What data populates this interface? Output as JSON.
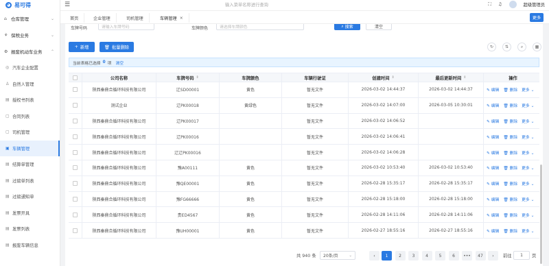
{
  "app": {
    "logo_text": "易可得"
  },
  "header": {
    "search_placeholder": "输入菜单名称进行查询",
    "user_name": "超级管理员"
  },
  "sidebar": {
    "groups": [
      {
        "label": "仓库管理"
      },
      {
        "label": "保税业务"
      },
      {
        "label": "报废机动车业务"
      }
    ],
    "items": [
      {
        "label": "汽车企业配置"
      },
      {
        "label": "自然人管理"
      },
      {
        "label": "授权书列表"
      },
      {
        "label": "合同列表"
      },
      {
        "label": "司机管理"
      },
      {
        "label": "车辆管理"
      },
      {
        "label": "结算单管理"
      },
      {
        "label": "过磅单列表"
      },
      {
        "label": "过磅通知单"
      },
      {
        "label": "发票开具"
      },
      {
        "label": "发票列表"
      },
      {
        "label": "报废车辆信息"
      }
    ]
  },
  "tabs": [
    {
      "label": "首页"
    },
    {
      "label": "企业管理"
    },
    {
      "label": "司机管理"
    },
    {
      "label": "车辆管理",
      "close": "×"
    }
  ],
  "tab_more": "更多",
  "filters": {
    "plate_label": "车牌号码",
    "plate_placeholder": "请输入车牌号码",
    "color_label": "车牌颜色",
    "color_placeholder": "请选择车牌颜色",
    "search_button": "搜索",
    "reset_button": "清空"
  },
  "toolbar": {
    "add_button": "新增",
    "batch_delete_button": "批量删除"
  },
  "selection": {
    "prefix": "当前表格已选择",
    "count": "0",
    "unit": "项",
    "clear": "清空"
  },
  "table": {
    "columns": [
      "公司名称",
      "车牌号码",
      "车牌颜色",
      "车辆行驶证",
      "创建时间",
      "最后更新时间",
      "操作"
    ],
    "actions": {
      "edit": "编辑",
      "delete": "删除",
      "more": "更多"
    },
    "rows": [
      {
        "company": "陕西秦鼎合循环科技有限公司",
        "plate": "辽SD00001",
        "color": "黄色",
        "license": "暂无文件",
        "created": "2026-03-02 14:44:37",
        "updated": "2026-03-02 14:44:37"
      },
      {
        "company": "测试企业",
        "plate": "辽PK00018",
        "color": "黄绿色",
        "license": "暂无文件",
        "created": "2026-03-02 14:07:00",
        "updated": "2026-03-05 10:30:01"
      },
      {
        "company": "陕西秦鼎合循环科技有限公司",
        "plate": "辽PK00017",
        "color": "",
        "license": "暂无文件",
        "created": "2026-03-02 14:06:52",
        "updated": ""
      },
      {
        "company": "陕西秦鼎合循环科技有限公司",
        "plate": "辽PK00016",
        "color": "",
        "license": "暂无文件",
        "created": "2026-03-02 14:06:41",
        "updated": ""
      },
      {
        "company": "陕西秦鼎合循环科技有限公司",
        "plate": "辽辽PK00016",
        "color": "",
        "license": "暂无文件",
        "created": "2026-03-02 14:06:28",
        "updated": ""
      },
      {
        "company": "陕西秦鼎合循环科技有限公司",
        "plate": "豫A00111",
        "color": "黄色",
        "license": "暂无文件",
        "created": "2026-03-02 10:53:40",
        "updated": "2026-03-02 10:53:40"
      },
      {
        "company": "陕西秦鼎合循环科技有限公司",
        "plate": "豫QE00001",
        "color": "黄色",
        "license": "暂无文件",
        "created": "2026-02-28 15:35:17",
        "updated": "2026-02-28 15:35:17"
      },
      {
        "company": "陕西秦鼎合循环科技有限公司",
        "plate": "豫FG66666",
        "color": "黄色",
        "license": "暂无文件",
        "created": "2026-02-28 15:18:00",
        "updated": "2026-02-28 15:18:00"
      },
      {
        "company": "陕西秦鼎合循环科技有限公司",
        "plate": "贵ED4567",
        "color": "黄色",
        "license": "暂无文件",
        "created": "2026-02-28 14:11:06",
        "updated": "2026-02-28 14:11:06"
      },
      {
        "company": "陕西秦鼎合循环科技有限公司",
        "plate": "豫UH00001",
        "color": "黄色",
        "license": "暂无文件",
        "created": "2026-02-27 18:55:16",
        "updated": "2026-02-27 18:55:16"
      }
    ]
  },
  "pagination": {
    "total_text": "共 940 条",
    "page_size": "20条/页",
    "prev": "‹",
    "next": "›",
    "pages": [
      "1",
      "2",
      "3",
      "4",
      "5",
      "6",
      "•••",
      "47"
    ],
    "current": "1",
    "goto_label": "前往",
    "goto_value": "1",
    "goto_suffix": "页"
  },
  "icons": {
    "logo": "◕",
    "hamburger": "☰",
    "fullscreen": "⛶",
    "bell": "♫",
    "warehouse": "⌂",
    "bond": "⚘",
    "scrap": "⚙",
    "item": "◎",
    "chevron_down": "⌄",
    "plus": "+",
    "trash": "🗑",
    "refresh": "↻",
    "density": "⇅",
    "search": "⌕",
    "columns": "▦",
    "edit": "✎",
    "del": "⌫"
  },
  "accent_color": "#2a7ae2"
}
